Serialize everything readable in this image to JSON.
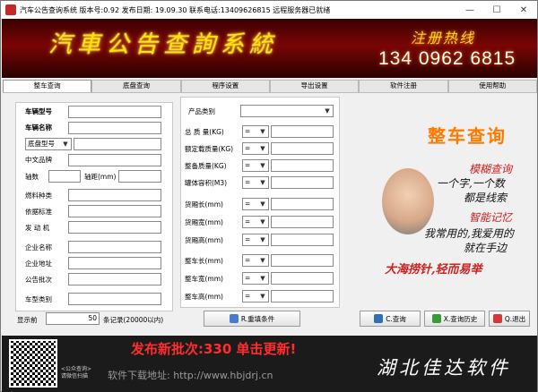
{
  "window": {
    "title": "汽车公告查询系统  版本号:0.92 发布日期: 19.09.30  联系电话:13409626815  远程服务器已就绪",
    "minimize": "—",
    "maximize": "☐",
    "close": "✕"
  },
  "banner": {
    "system_name": "汽車公告查詢系統",
    "hotline_label": "注册热线",
    "hotline_number": "134 0962 6815"
  },
  "tabs": [
    "整车查询",
    "底盘查询",
    "程序设置",
    "导出设置",
    "软件注册",
    "使用帮助"
  ],
  "left_form": {
    "vehicle_model": "车辆型号",
    "vehicle_name": "车辆名称",
    "chassis_model": "底盘型号",
    "chinese_brand": "中文品牌",
    "axle_count": "轴数",
    "wheelbase": "轴距(mm)",
    "fuel_type": "燃料种类",
    "standard": "依据标准",
    "engine": "发 动 机",
    "company_name": "企业名称",
    "company_address": "企业地址",
    "batch": "公告批次",
    "vehicle_category": "车型类别"
  },
  "mid_form": {
    "product_category": "产品类别",
    "total_mass": "总 质 量(KG)",
    "rated_load": "额定载质量(KG)",
    "curb_mass": "整备质量(KG)",
    "tank_volume": "罐体容积(M3)",
    "cargo_length": "货厢长(mm)",
    "cargo_width": "货厢宽(mm)",
    "cargo_height": "货厢高(mm)",
    "overall_length": "整车长(mm)",
    "overall_width": "整车宽(mm)",
    "overall_height": "整车高(mm)",
    "operator": "="
  },
  "bottom_controls": {
    "show_prefix": "显示前",
    "record_count": "50",
    "show_suffix": "条记录(20000以内)",
    "reset_button": "R.重填条件",
    "query_button": "C.查询",
    "history_button": "X.查询历史",
    "exit_button": "Q.退出"
  },
  "promo": {
    "title": "整车查询",
    "line1": "模糊查询",
    "line2": "一个字,一个数",
    "line3": "都是线索",
    "line4": "智能记忆",
    "line5": "我常用的,我爱用的",
    "line6": "就在手边",
    "line7": "大海捞针,轻而易举"
  },
  "footer": {
    "qr_caption": "<公众查询>请微信扫描",
    "notice": "发布新批次:330 单击更新!",
    "download": "软件下载地址: http://www.hbjdrj.cn",
    "brand": "湖北佳达软件"
  },
  "colors": {
    "banner_red": "#7a0505",
    "promo_orange": "#ff7a00",
    "notice_red": "#ff2d2d"
  }
}
